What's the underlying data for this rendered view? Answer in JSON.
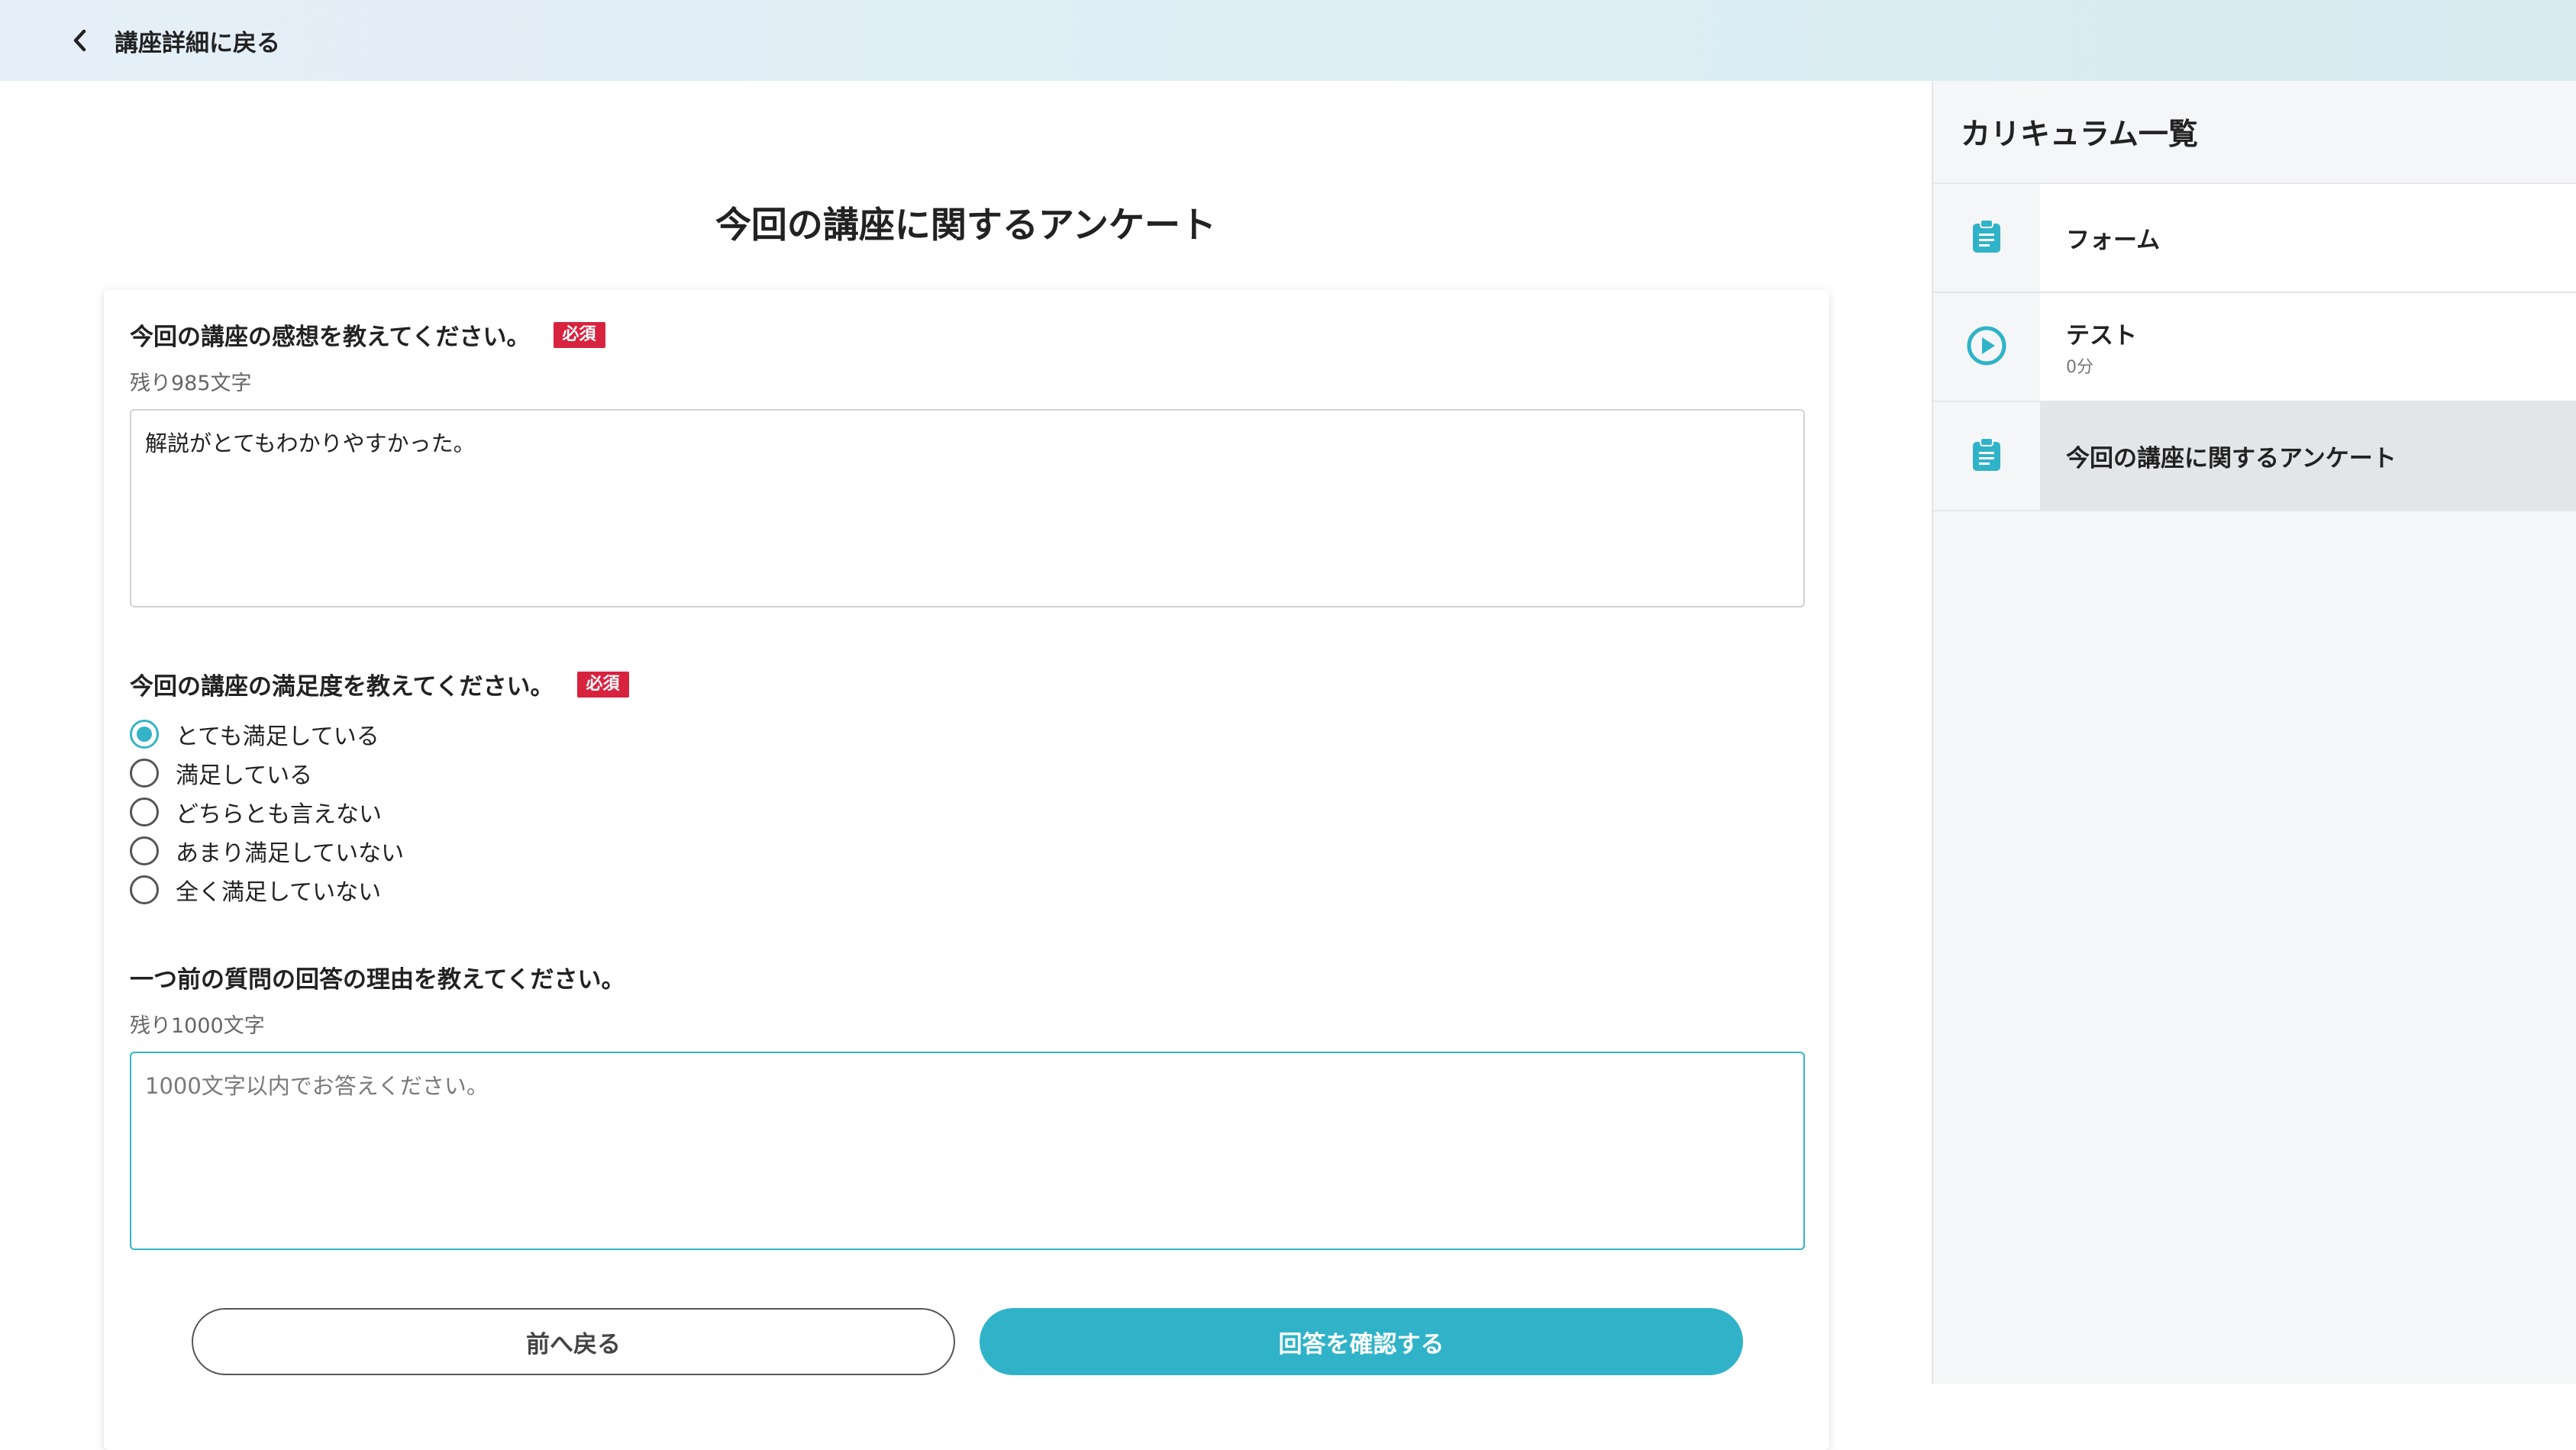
{
  "header": {
    "back_label": "講座詳細に戻る",
    "back_icon": "chevron-left-icon"
  },
  "main": {
    "title": "今回の講座に関するアンケート",
    "required_badge": "必須",
    "q1": {
      "title": "今回の講座の感想を教えてください。",
      "remaining": "残り985文字",
      "value": "解説がとてもわかりやすかった。"
    },
    "q2": {
      "title": "今回の講座の満足度を教えてください。",
      "selected": "とても満足している",
      "options": [
        "とても満足している",
        "満足している",
        "どちらとも言えない",
        "あまり満足していない",
        "全く満足していない"
      ]
    },
    "q3": {
      "title": "一つ前の質問の回答の理由を教えてください。",
      "remaining": "残り1000文字",
      "value": "",
      "placeholder": "1000文字以内でお答えください。"
    },
    "buttons": {
      "back": "前へ戻る",
      "confirm": "回答を確認する"
    }
  },
  "sidebar": {
    "title": "カリキュラム一覧",
    "items": [
      {
        "label": "フォーム",
        "sub": "",
        "icon": "clipboard-icon",
        "active": false
      },
      {
        "label": "テスト",
        "sub": "0分",
        "icon": "play-circle-icon",
        "active": false
      },
      {
        "label": "今回の講座に関するアンケート",
        "sub": "",
        "icon": "clipboard-icon",
        "active": true
      }
    ]
  },
  "colors": {
    "accent": "#30b3c8",
    "required": "#d8233f",
    "header_bg_start": "#e6eff9",
    "header_bg_end": "#d6ecf1"
  }
}
